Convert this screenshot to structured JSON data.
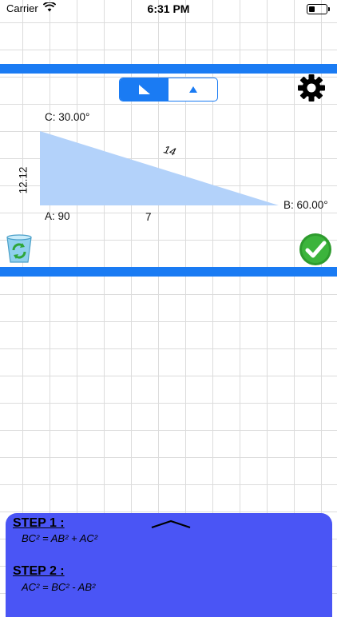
{
  "status_bar": {
    "carrier": "Carrier",
    "time": "6:31 PM"
  },
  "triangle": {
    "fill_color": "#b3d2fa",
    "label_c": "C: 30.00°",
    "label_a": "A: 90",
    "label_b": "B: 60.00°",
    "side_ab": "7",
    "side_bc": "14",
    "side_ac": "12.12"
  },
  "toolbar": {
    "segment_right_triangle": "right-triangle-icon",
    "segment_general_triangle": "triangle-icon",
    "settings": "gear-icon",
    "clear": "trash-icon",
    "solve": "checkmark-icon"
  },
  "colors": {
    "accent": "#1a7bf3",
    "panel": "#4a55f5",
    "check": "#2e9b2e"
  },
  "steps": [
    {
      "title": "STEP 1 :",
      "equation": "BC² = AB² + AC²"
    },
    {
      "title": "STEP 2 :",
      "equation": "AC² = BC² - AB²"
    }
  ]
}
